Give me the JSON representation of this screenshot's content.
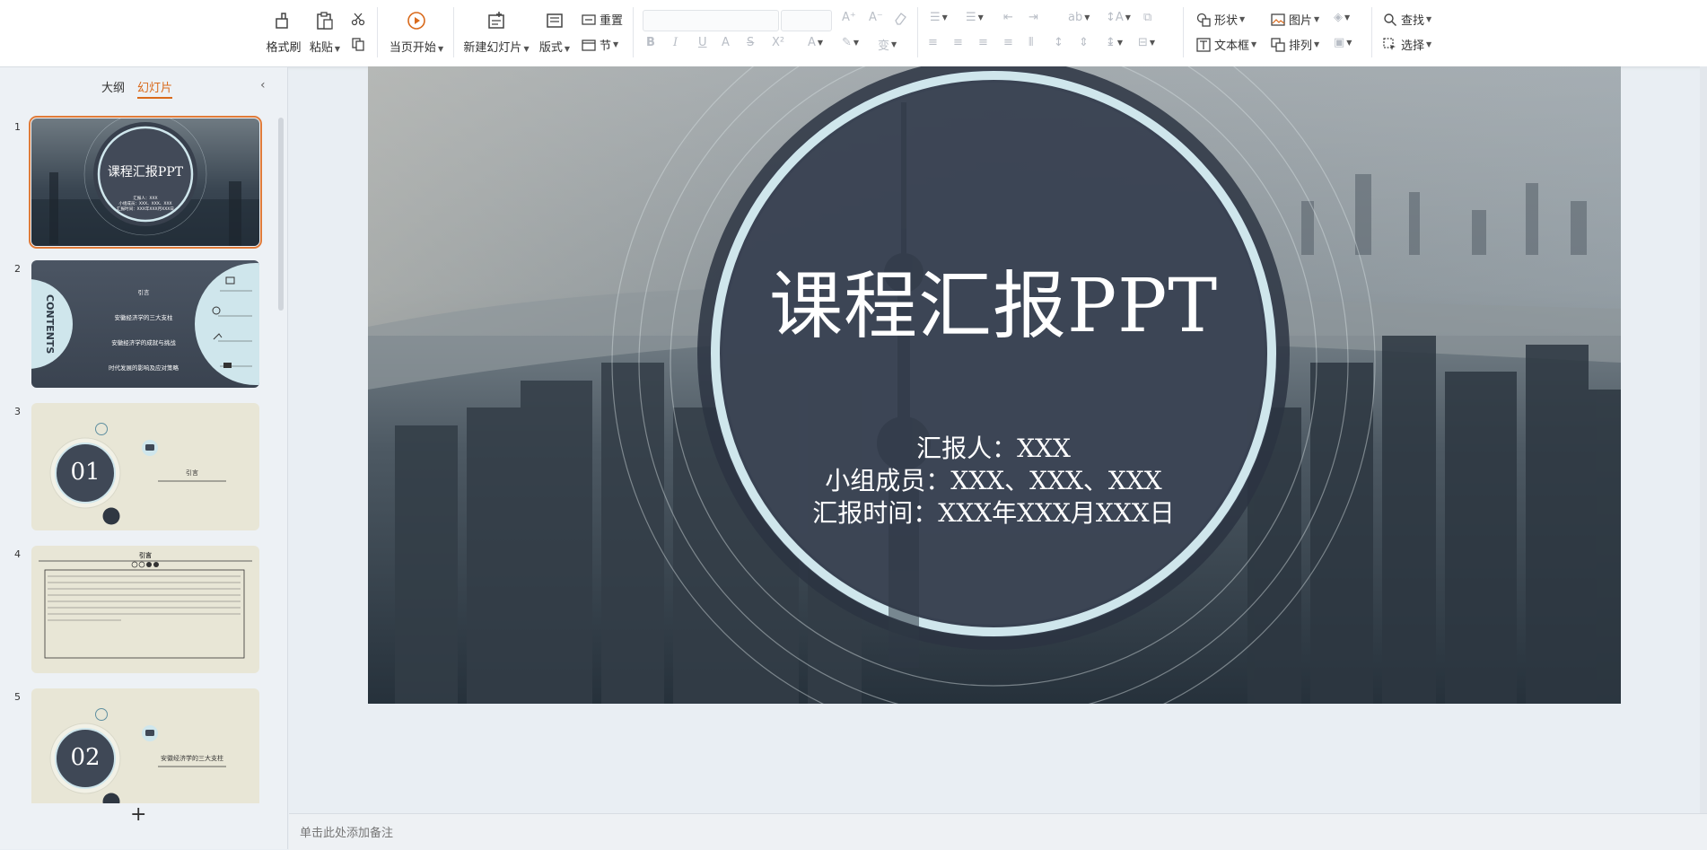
{
  "toolbar": {
    "format_painter": "格式刷",
    "paste": "粘贴",
    "play_from_current": "当页开始",
    "new_slide": "新建幻灯片",
    "layout": "版式",
    "reset": "重置",
    "section": "节",
    "shape": "形状",
    "picture": "图片",
    "textbox": "文本框",
    "arrange": "排列",
    "find": "查找",
    "select": "选择"
  },
  "left_panel": {
    "tab_outline": "大纲",
    "tab_slides": "幻灯片",
    "add_slide_symbol": "+",
    "slides": [
      {
        "number": "1",
        "title": "课程汇报PPT",
        "lines": [
          "汇报人：XXX",
          "小组成员：XXX、XXX、XXX",
          "汇报时间：XXX年XXX月XXX日"
        ]
      },
      {
        "number": "2",
        "side_title": "CONTENTS",
        "items": [
          "引言",
          "安徽经济学的三大支柱",
          "安徽经济学的成就与挑战",
          "时代发展的影响及应对策略"
        ]
      },
      {
        "number": "3",
        "section_number": "01",
        "label": "引言"
      },
      {
        "number": "4",
        "heading": "引言"
      },
      {
        "number": "5",
        "section_number": "02",
        "label": "安徽经济学的三大支柱"
      }
    ]
  },
  "slide": {
    "title": "课程汇报PPT",
    "reporter": "汇报人：XXX",
    "members": "小组成员：XXX、XXX、XXX",
    "time": "汇报时间：XXX年XXX月XXX日"
  },
  "notes_placeholder": "单击此处添加备注",
  "colors": {
    "accent_orange": "#d96a1c",
    "circle_ring": "#cfe6ec",
    "circle_fill": "#3b4252"
  }
}
